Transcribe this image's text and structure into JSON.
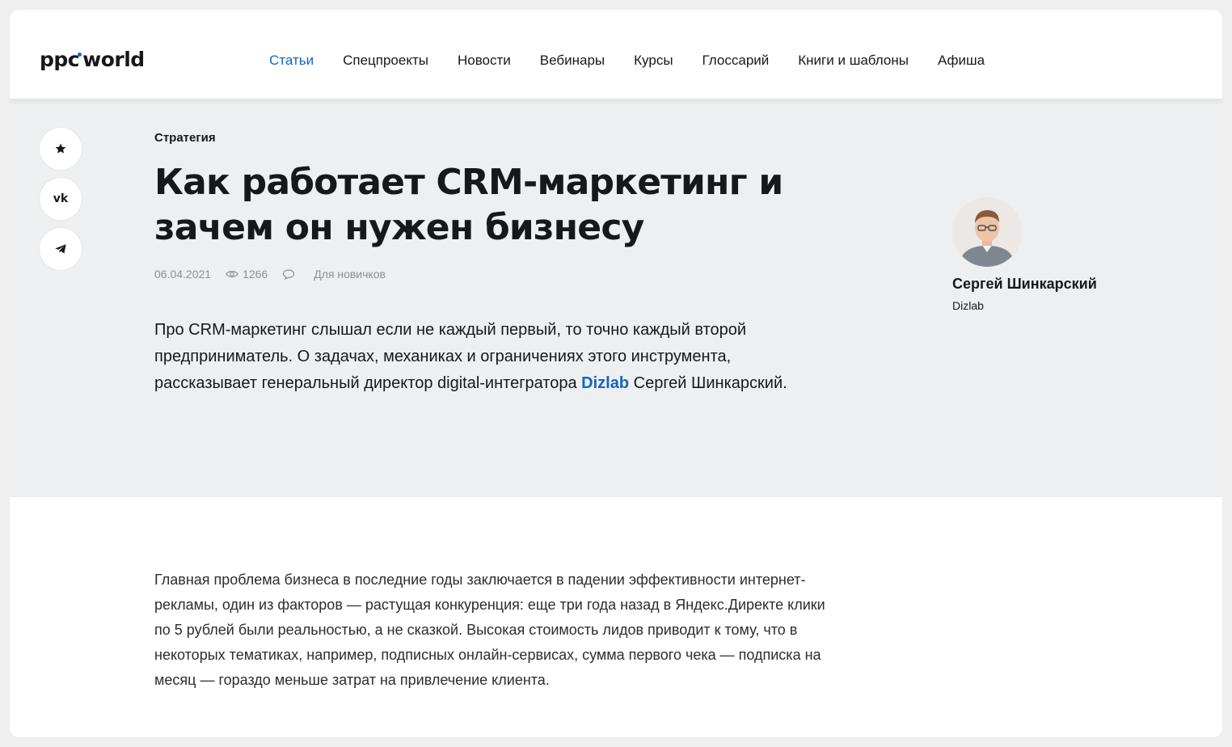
{
  "header": {
    "logo_left": "ppc",
    "logo_right": "world",
    "nav": [
      {
        "label": "Статьи",
        "active": true
      },
      {
        "label": "Спецпроекты",
        "active": false
      },
      {
        "label": "Новости",
        "active": false
      },
      {
        "label": "Вебинары",
        "active": false
      },
      {
        "label": "Курсы",
        "active": false
      },
      {
        "label": "Глоссарий",
        "active": false
      },
      {
        "label": "Книги и шаблоны",
        "active": false
      },
      {
        "label": "Афиша",
        "active": false
      }
    ]
  },
  "share": {
    "icons": [
      "star-icon",
      "vk-icon",
      "telegram-icon"
    ],
    "vk_label": "vk"
  },
  "article": {
    "category": "Стратегия",
    "title": "Как работает CRM-маркетинг и зачем он нужен бизнесу",
    "date": "06.04.2021",
    "views": "1266",
    "level": "Для новичков",
    "lead_before": "Про CRM-маркетинг слышал если не каждый первый, то точно каждый второй предприниматель. О задачах, механиках и ограничениях этого инструмента, рассказывает генеральный директор digital-интегратора",
    "lead_link": "Dizlab",
    "lead_after": "Сергей Шинкарский.",
    "body": "Главная проблема бизнеса в последние годы заключается в падении эффективности интернет-рекламы, один из факторов — растущая конкуренция: еще три года назад в Яндекс.Директе клики по 5 рублей были реальностью, а не сказкой. Высокая стоимость лидов приводит к тому, что в некоторых тематиках, например, подписных онлайн-сервисах, сумма первого чека — подписка на месяц — гораздо меньше затрат на привлечение клиента."
  },
  "author": {
    "name": "Сергей Шинкарский",
    "company": "Dizlab"
  },
  "colors": {
    "accent": "#1565c0",
    "hero_bg": "#eeeff1",
    "text": "#16181c",
    "muted": "#8d9096"
  }
}
